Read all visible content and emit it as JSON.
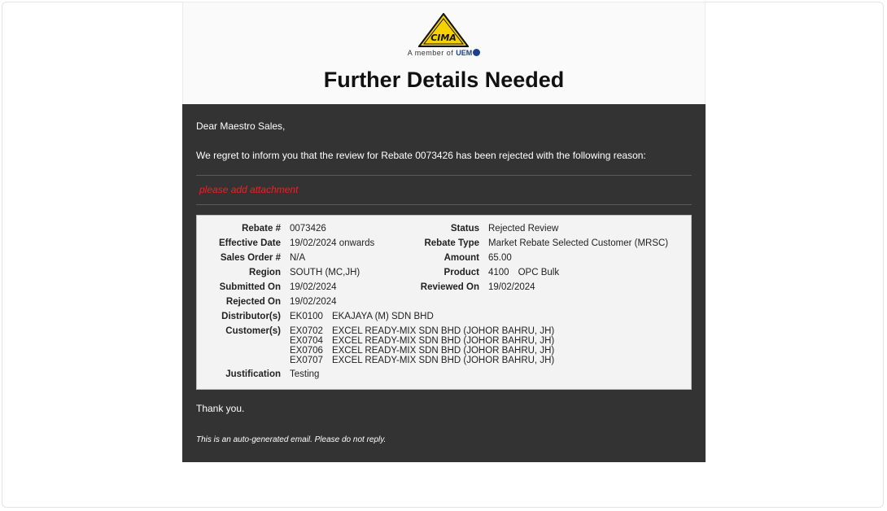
{
  "header": {
    "logo_text": "CIMA",
    "member_prefix": "A member of",
    "member_brand": "UEM",
    "title": "Further Details Needed"
  },
  "body": {
    "greeting": "Dear Maestro Sales,",
    "intro": "We regret to inform you that the review for Rebate 0073426 has been rejected with the following reason:",
    "reason": "please add attachment",
    "details": {
      "rebate_label": "Rebate #",
      "rebate_value": "0073426",
      "status_label": "Status",
      "status_value": "Rejected Review",
      "effective_label": "Effective Date",
      "effective_value": "19/02/2024 onwards",
      "rebate_type_label": "Rebate Type",
      "rebate_type_value": "Market Rebate Selected Customer (MRSC)",
      "sales_order_label": "Sales Order #",
      "sales_order_value": "N/A",
      "amount_label": "Amount",
      "amount_value": "65.00",
      "region_label": "Region",
      "region_value": "SOUTH (MC,JH)",
      "product_label": "Product",
      "product_code": "4100",
      "product_name": "OPC Bulk",
      "submitted_label": "Submitted On",
      "submitted_value": "19/02/2024",
      "reviewed_label": "Reviewed On",
      "reviewed_value": "19/02/2024",
      "rejected_label": "Rejected On",
      "rejected_value": "19/02/2024",
      "distributor_label": "Distributor(s)",
      "distributor_code": "EK0100",
      "distributor_name": "EKAJAYA (M) SDN BHD",
      "customers_label": "Customer(s)",
      "customers": [
        {
          "code": "EX0702",
          "name": "EXCEL READY-MIX SDN BHD (JOHOR BAHRU, JH)"
        },
        {
          "code": "EX0704",
          "name": "EXCEL READY-MIX SDN BHD (JOHOR BAHRU, JH)"
        },
        {
          "code": "EX0706",
          "name": "EXCEL READY-MIX SDN BHD (JOHOR BAHRU, JH)"
        },
        {
          "code": "EX0707",
          "name": "EXCEL READY-MIX SDN BHD (JOHOR BAHRU, JH)"
        }
      ],
      "justification_label": "Justification",
      "justification_value": "Testing"
    },
    "thanks": "Thank you.",
    "auto_note": "This is an auto-generated email. Please do not reply."
  },
  "colors": {
    "body_bg": "#333333",
    "reason_red": "#ff1a1a",
    "logo_yellow": "#f5d100",
    "uem_blue": "#1d3f8f"
  }
}
